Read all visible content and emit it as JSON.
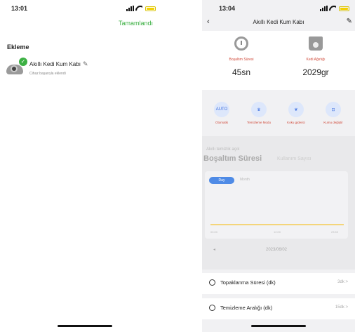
{
  "left": {
    "time": "13:01",
    "done_label": "Tamamlandı",
    "section_title": "Ekleme",
    "device_name": "Akıllı Kedi Kum Kabı",
    "device_status": "Cihaz başarıyla eklendi"
  },
  "right": {
    "time": "13:04",
    "title": "Akıllı Kedi Kum Kabı",
    "stats": [
      {
        "label": "Boşaltım Süresi",
        "value": "45sn",
        "icon": "clock-icon"
      },
      {
        "label": "Kedi Ağırlığı",
        "value": "2029gr",
        "icon": "scale-icon"
      }
    ],
    "modes": [
      {
        "label": "Otomatik",
        "icon_text": "AUTO"
      },
      {
        "label": "Temizleme Modu",
        "icon_text": "♛"
      },
      {
        "label": "Koku giderici",
        "icon_text": "❦"
      },
      {
        "label": "Kumu değiştir",
        "icon_text": "⊡"
      }
    ],
    "cleaning_hint": "Akıllı temizlik açık",
    "tab_active": "Boşaltım Süresi",
    "tab_inactive": "Kullanım Sayısı",
    "period_active": "Day",
    "period_inactive": "Month",
    "chart_ticks": [
      "00:00",
      "12:00",
      "23:59"
    ],
    "date": "2023/06/02",
    "rows": [
      {
        "label": "Topaklanma Süresi (dk)",
        "value": "3dk"
      },
      {
        "label": "Temizleme Aralığı (dk)",
        "value": "15dk"
      }
    ]
  },
  "colors": {
    "accent_green": "#3cb043",
    "accent_blue": "#4f8be6",
    "chart_line": "#f5b800",
    "label_red": "#d04a3a"
  }
}
